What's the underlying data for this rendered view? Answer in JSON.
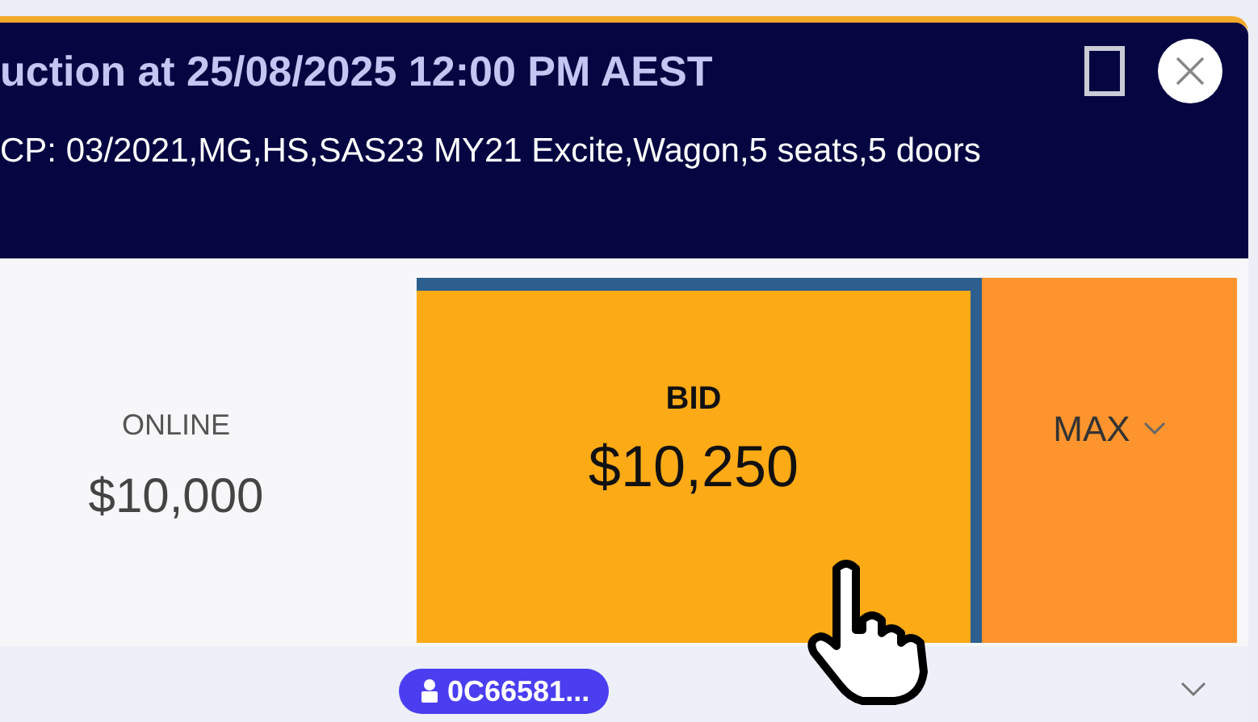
{
  "header": {
    "title": "uction at 25/08/2025 12:00 PM AEST",
    "subtitle": "CP: 03/2021,MG,HS,SAS23 MY21 Excite,Wagon,5 seats,5 doors"
  },
  "online": {
    "label": "ONLINE",
    "amount": "$10,000"
  },
  "bid": {
    "label": "BID",
    "amount": "$10,250"
  },
  "max": {
    "label": "MAX"
  },
  "footer": {
    "badge": "0C66581..."
  }
}
